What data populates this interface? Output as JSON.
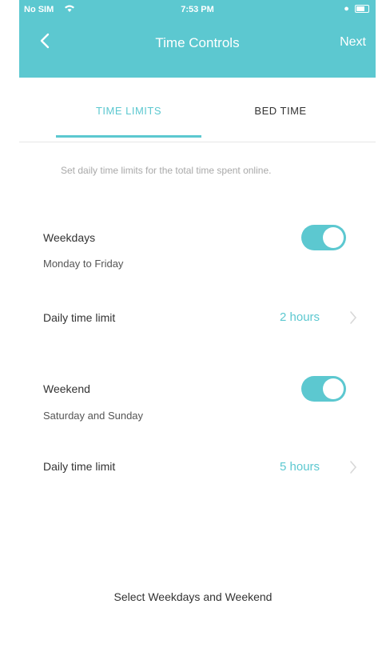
{
  "status_bar": {
    "carrier": "No SIM",
    "time": "7:53 PM"
  },
  "nav": {
    "title": "Time Controls",
    "next_label": "Next"
  },
  "tabs": [
    {
      "label": "TIME LIMITS",
      "active": true
    },
    {
      "label": "BED TIME",
      "active": false
    }
  ],
  "description": "Set daily time limits for the total time spent online.",
  "weekdays": {
    "title": "Weekdays",
    "subtitle": "Monday to Friday",
    "enabled": true,
    "limit_label": "Daily time limit",
    "limit_value": "2 hours"
  },
  "weekend": {
    "title": "Weekend",
    "subtitle": "Saturday and Sunday",
    "enabled": true,
    "limit_label": "Daily time limit",
    "limit_value": "5 hours"
  },
  "bottom_action": "Select Weekdays and Weekend",
  "colors": {
    "accent": "#5cc8d0",
    "text": "#333333",
    "muted": "#a9a9a9"
  }
}
